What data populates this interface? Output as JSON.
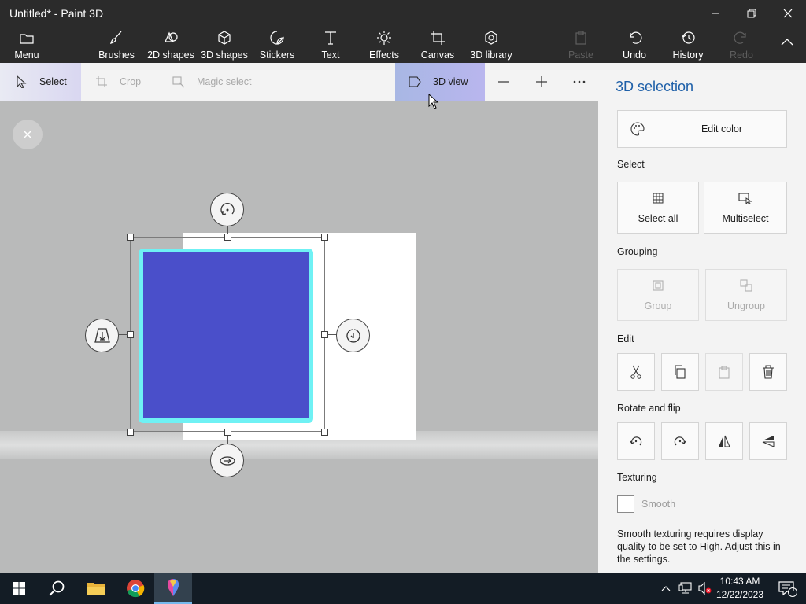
{
  "window": {
    "title": "Untitled* - Paint 3D"
  },
  "ribbon": {
    "menu": "Menu",
    "brushes": "Brushes",
    "shapes2d": "2D shapes",
    "shapes3d": "3D shapes",
    "stickers": "Stickers",
    "text": "Text",
    "effects": "Effects",
    "canvas": "Canvas",
    "library3d": "3D library",
    "paste": "Paste",
    "undo": "Undo",
    "history": "History",
    "redo": "Redo"
  },
  "toolbar": {
    "select": "Select",
    "crop": "Crop",
    "magic_select": "Magic select",
    "view3d": "3D view"
  },
  "panel": {
    "title": "3D selection",
    "edit_color": "Edit color",
    "select_heading": "Select",
    "select_all": "Select all",
    "multiselect": "Multiselect",
    "grouping_heading": "Grouping",
    "group": "Group",
    "ungroup": "Ungroup",
    "edit_heading": "Edit",
    "rotate_heading": "Rotate and flip",
    "texturing_heading": "Texturing",
    "smooth": "Smooth",
    "note": "Smooth texturing requires display quality to be set to High. Adjust this in the settings."
  },
  "taskbar": {
    "time": "10:43 AM",
    "date": "12/22/2023",
    "notification_count": "1"
  },
  "colors": {
    "shape_fill": "#4a4fca",
    "shape_glow": "#6ff1f4",
    "accent": "#1d5fa8"
  }
}
